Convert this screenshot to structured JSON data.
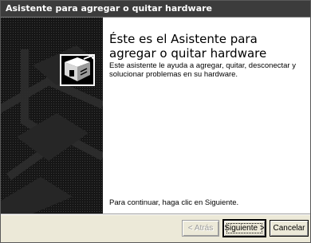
{
  "window": {
    "title": "Asistente para agregar o quitar hardware"
  },
  "banner": {
    "icon": "hardware-wizard-icon"
  },
  "content": {
    "heading": "Éste es el Asistente para agregar o quitar hardware",
    "description": "Este asistente le ayuda a agregar, quitar, desconectar y solucionar problemas en su hardware.",
    "continue_text": "Para continuar, haga clic en Siguiente."
  },
  "buttons": {
    "back": "< Atrás",
    "next": "Siguiente >",
    "cancel": "Cancelar"
  }
}
